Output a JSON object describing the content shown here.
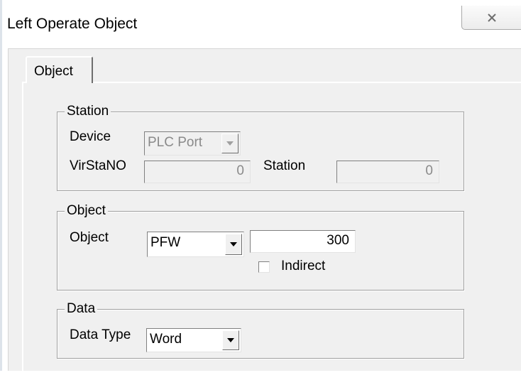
{
  "window": {
    "title": "Left Operate Object",
    "close_icon": "close-icon"
  },
  "tabs": [
    {
      "label": "Object",
      "selected": true
    }
  ],
  "station_group": {
    "legend": "Station",
    "device_label": "Device",
    "device_value": "PLC Port",
    "virstano_label": "VirStaNO",
    "virstano_value": "0",
    "station_label": "Station",
    "station_value": "0"
  },
  "object_group": {
    "legend": "Object",
    "object_label": "Object",
    "object_type": "PFW",
    "object_address": "300",
    "indirect_label": "Indirect",
    "indirect_checked": false
  },
  "data_group": {
    "legend": "Data",
    "data_type_label": "Data Type",
    "data_type_value": "Word"
  },
  "colors": {
    "dialog_bg": "#f0f0f0",
    "disabled_text": "#8a8a8a",
    "group_border": "#a0a0a0"
  }
}
